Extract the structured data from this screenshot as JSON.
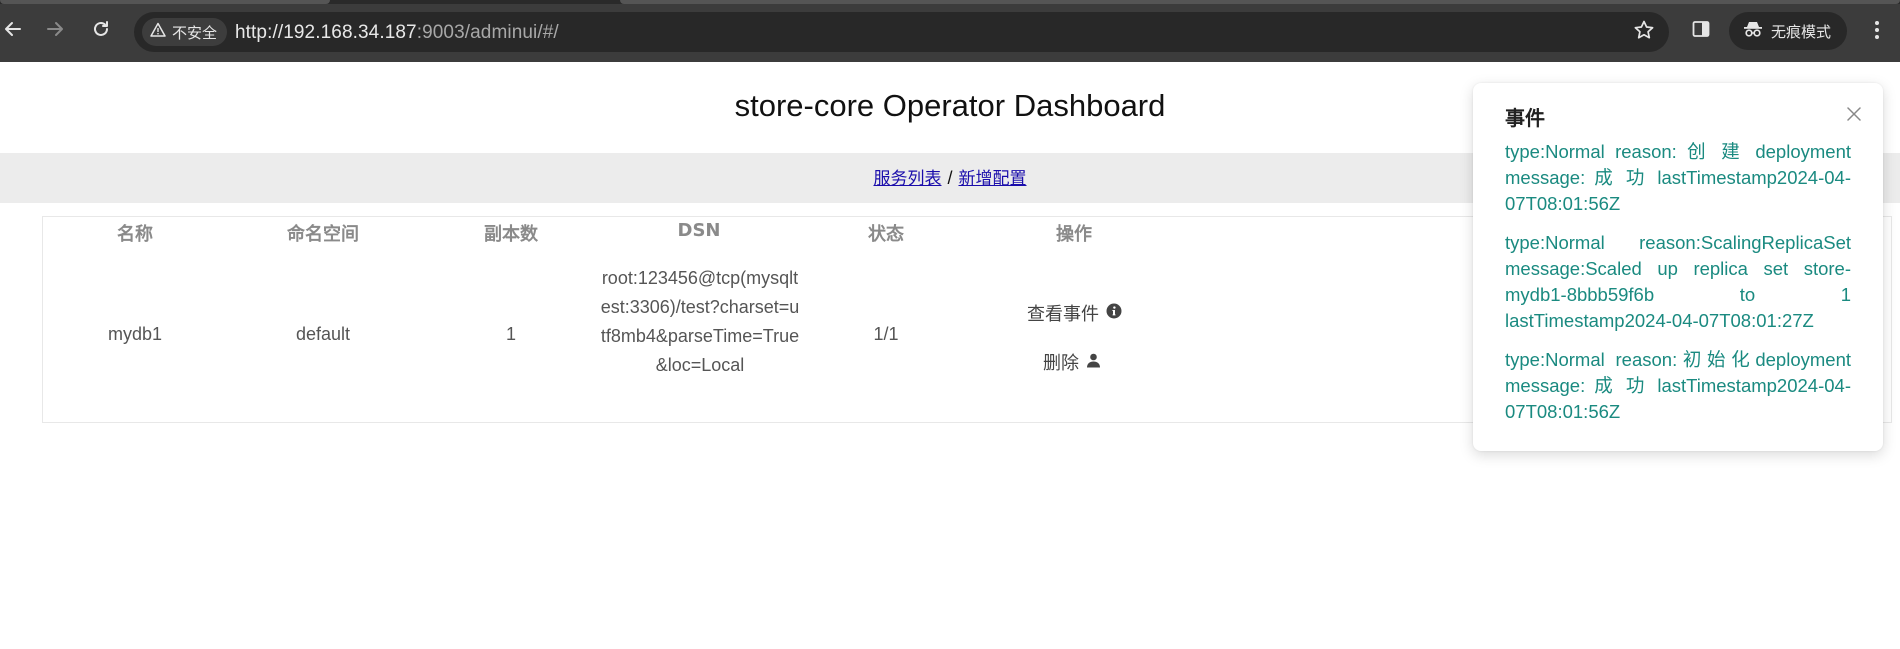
{
  "browser": {
    "security_label": "不安全",
    "url_host": "http://192.168.34.187",
    "url_rest": ":9003/adminui/#/",
    "incognito_label": "无痕模式"
  },
  "page": {
    "title": "store-core Operator Dashboard",
    "nav": {
      "link1": "服务列表",
      "separator": "/",
      "link2": "新增配置"
    }
  },
  "table": {
    "headers": [
      "名称",
      "命名空间",
      "副本数",
      "DSN",
      "状态",
      "操作"
    ],
    "rows": [
      {
        "name": "mydb1",
        "namespace": "default",
        "replicas": "1",
        "dsn": "root:123456@tcp(mysqltest:3306)/test?charset=utf8mb4&parseTime=True&loc=Local",
        "status": "1/1",
        "action_view": "查看事件",
        "action_delete": "删除"
      }
    ]
  },
  "notification": {
    "title": "事件",
    "events": [
      "type:Normal reason: 创 建 deployment message: 成 功 lastTimestamp2024-04-07T08:01:56Z",
      "type:Normal reason:ScalingReplicaSet message:Scaled up replica set store-mydb1-8bbb59f6b to 1 lastTimestamp2024-04-07T08:01:27Z",
      "type:Normal reason:初始化deployment message: 成 功 lastTimestamp2024-04-07T08:01:56Z"
    ]
  },
  "colors": {
    "event_text": "#1a8a80",
    "link": "#1a0dab",
    "chrome_bg": "#3c3c3c",
    "nav_bg": "#ececec"
  },
  "icons": {
    "back": "arrow-left-icon",
    "forward": "arrow-right-icon",
    "reload": "reload-icon",
    "warning": "warning-triangle-icon",
    "bookmark": "star-icon",
    "side_panel": "side-panel-icon",
    "incognito": "incognito-icon",
    "menu": "kebab-menu-icon",
    "info": "info-circle-icon",
    "user": "user-icon",
    "close": "close-icon"
  }
}
